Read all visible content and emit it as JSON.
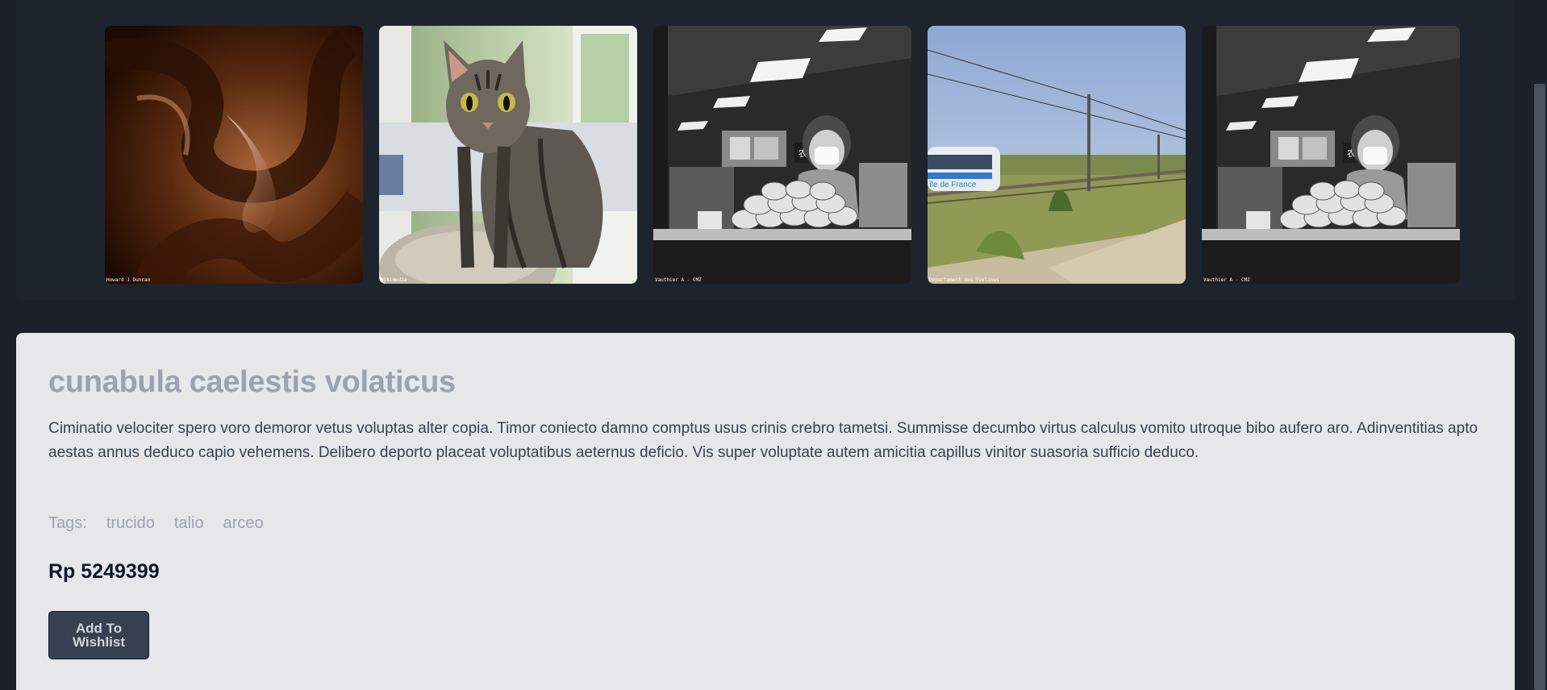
{
  "gallery": {
    "images": [
      {
        "alt": "abstract brown swirl",
        "credit": "Howard J Duncan"
      },
      {
        "alt": "tabby cat on a scratching post",
        "credit": "Wikimedia"
      },
      {
        "alt": "vendor at a bakery stall",
        "credit": "Vauthier A - CMZ"
      },
      {
        "alt": "train passing a field",
        "credit": "Département des Yvelines"
      },
      {
        "alt": "vendor at a bakery stall",
        "credit": "Vauthier A - CMZ"
      }
    ]
  },
  "product": {
    "title": "cunabula caelestis volaticus",
    "description": "Ciminatio velociter spero voro demoror vetus voluptas alter copia. Timor coniecto damno comptus usus crinis crebro tametsi. Summisse decumbo virtus calculus vomito utroque bibo aufero aro. Adinventitias apto aestas annus deduco capio vehemens. Delibero deporto placeat voluptatibus aeternus deficio. Vis super voluptate autem amicitia capillus vinitor suasoria sufficio deduco.",
    "tags_label": "Tags:",
    "tags": [
      "trucido",
      "talio",
      "arceo"
    ],
    "price": "Rp 5249399",
    "wishlist_label": "Add To Wishlist"
  },
  "colors": {
    "page_bg": "#1b202a",
    "card_bg": "#e5e7eb",
    "button_bg": "#374151",
    "title": "#9ca3af"
  }
}
